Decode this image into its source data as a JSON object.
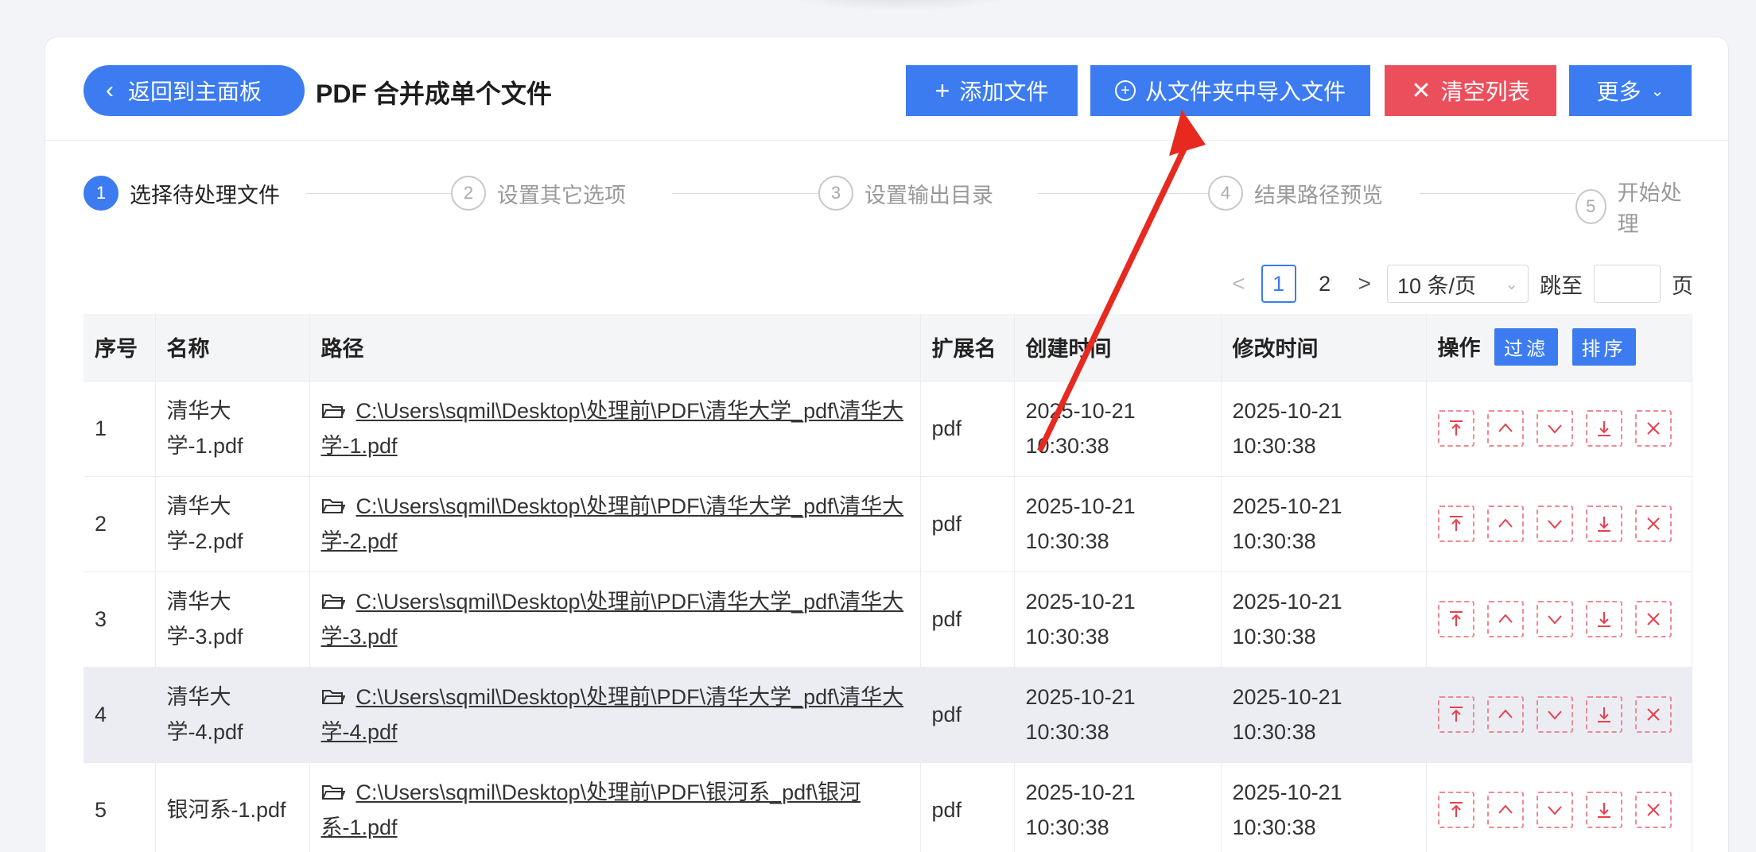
{
  "header": {
    "back_label": "返回到主面板",
    "title": "PDF 合并成单个文件",
    "buttons": {
      "add": "添加文件",
      "import": "从文件夹中导入文件",
      "clear": "清空列表",
      "more": "更多"
    }
  },
  "steps": [
    {
      "num": "1",
      "label": "选择待处理文件"
    },
    {
      "num": "2",
      "label": "设置其它选项"
    },
    {
      "num": "3",
      "label": "设置输出目录"
    },
    {
      "num": "4",
      "label": "结果路径预览"
    },
    {
      "num": "5",
      "label": "开始处理"
    }
  ],
  "pager": {
    "prev": "<",
    "pages": [
      "1",
      "2"
    ],
    "current": "1",
    "next": ">",
    "page_size": "10 条/页",
    "jump_label": "跳至",
    "page_suffix": "页"
  },
  "table": {
    "headers": {
      "index": "序号",
      "name": "名称",
      "path": "路径",
      "ext": "扩展名",
      "created": "创建时间",
      "modified": "修改时间",
      "ops": "操作",
      "filter": "过滤",
      "sort": "排序"
    },
    "rows": [
      {
        "index": "1",
        "name": "清华大学-1.pdf",
        "path": "C:\\Users\\sqmil\\Desktop\\处理前\\PDF\\清华大学_pdf\\清华大学-1.pdf",
        "ext": "pdf",
        "created": "2025-10-21 10:30:38",
        "modified": "2025-10-21 10:30:38"
      },
      {
        "index": "2",
        "name": "清华大学-2.pdf",
        "path": "C:\\Users\\sqmil\\Desktop\\处理前\\PDF\\清华大学_pdf\\清华大学-2.pdf",
        "ext": "pdf",
        "created": "2025-10-21 10:30:38",
        "modified": "2025-10-21 10:30:38"
      },
      {
        "index": "3",
        "name": "清华大学-3.pdf",
        "path": "C:\\Users\\sqmil\\Desktop\\处理前\\PDF\\清华大学_pdf\\清华大学-3.pdf",
        "ext": "pdf",
        "created": "2025-10-21 10:30:38",
        "modified": "2025-10-21 10:30:38"
      },
      {
        "index": "4",
        "name": "清华大学-4.pdf",
        "path": "C:\\Users\\sqmil\\Desktop\\处理前\\PDF\\清华大学_pdf\\清华大学-4.pdf",
        "ext": "pdf",
        "created": "2025-10-21 10:30:38",
        "modified": "2025-10-21 10:30:38"
      },
      {
        "index": "5",
        "name": "银河系-1.pdf",
        "path": "C:\\Users\\sqmil\\Desktop\\处理前\\PDF\\银河系_pdf\\银河系-1.pdf",
        "ext": "pdf",
        "created": "2025-10-21 10:30:38",
        "modified": "2025-10-21 10:30:38"
      }
    ]
  },
  "colors": {
    "primary": "#3c7cf0",
    "danger": "#ec4f5c",
    "annotation_arrow": "#e8291f"
  },
  "icons": [
    "chevron-left-icon",
    "plus-icon",
    "circle-plus-icon",
    "close-icon",
    "chevron-down-icon",
    "folder-icon",
    "move-top-icon",
    "move-up-icon",
    "move-down-icon",
    "move-bottom-icon",
    "delete-icon"
  ]
}
